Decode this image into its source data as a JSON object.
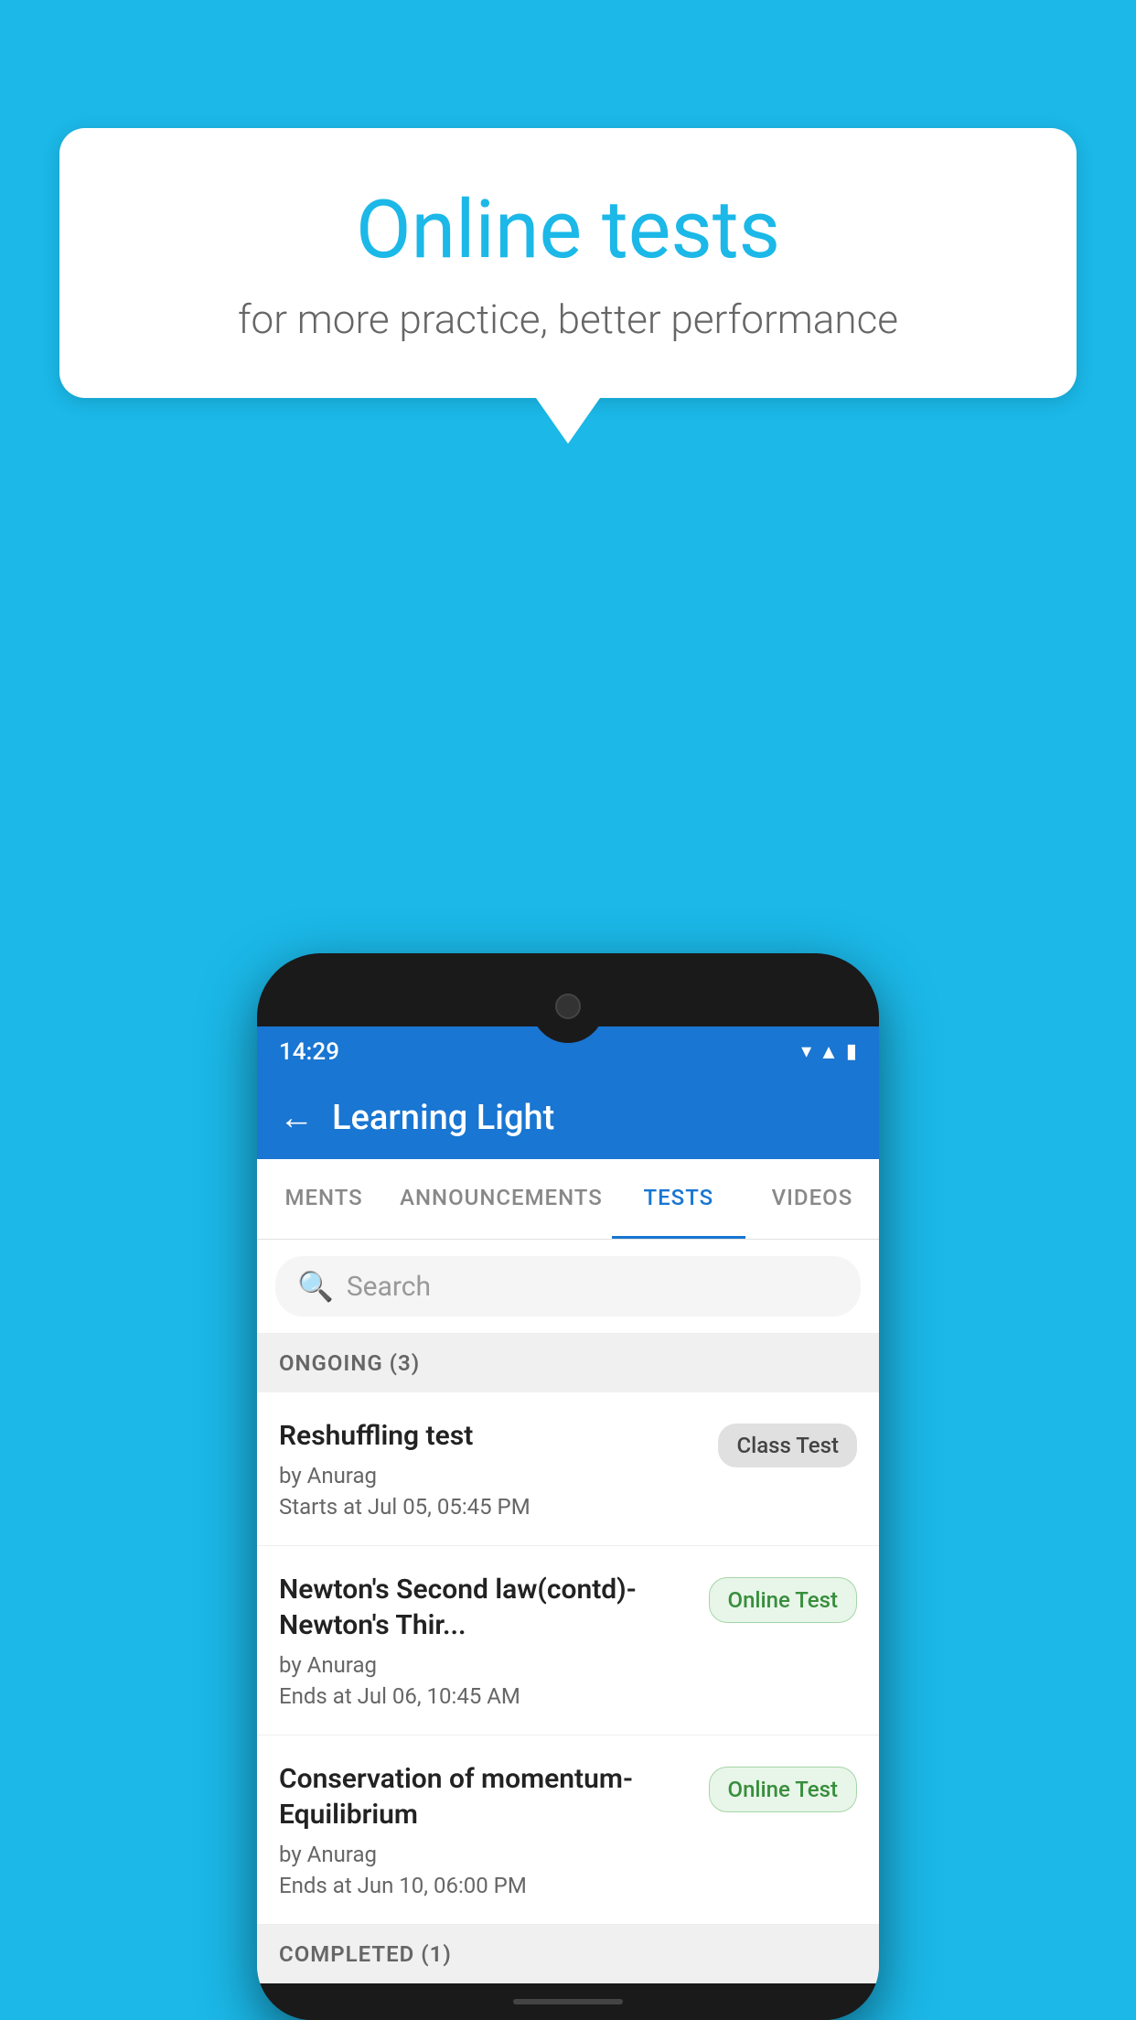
{
  "background_color": "#1BB8E8",
  "speech_bubble": {
    "title": "Online tests",
    "subtitle": "for more practice, better performance"
  },
  "phone": {
    "status_bar": {
      "time": "14:29",
      "wifi_icon": "▼",
      "signal_icon": "▲",
      "battery_icon": "▮"
    },
    "app_header": {
      "back_label": "←",
      "title": "Learning Light"
    },
    "tabs": [
      {
        "label": "MENTS",
        "active": false
      },
      {
        "label": "ANNOUNCEMENTS",
        "active": false
      },
      {
        "label": "TESTS",
        "active": true
      },
      {
        "label": "VIDEOS",
        "active": false
      }
    ],
    "search": {
      "placeholder": "Search"
    },
    "ongoing_section": {
      "label": "ONGOING (3)"
    },
    "tests": [
      {
        "title": "Reshuffling test",
        "author": "by Anurag",
        "date": "Starts at  Jul 05, 05:45 PM",
        "badge": "Class Test",
        "badge_type": "class"
      },
      {
        "title": "Newton's Second law(contd)-Newton's Thir...",
        "author": "by Anurag",
        "date": "Ends at  Jul 06, 10:45 AM",
        "badge": "Online Test",
        "badge_type": "online"
      },
      {
        "title": "Conservation of momentum-Equilibrium",
        "author": "by Anurag",
        "date": "Ends at  Jun 10, 06:00 PM",
        "badge": "Online Test",
        "badge_type": "online"
      }
    ],
    "completed_section": {
      "label": "COMPLETED (1)"
    }
  }
}
